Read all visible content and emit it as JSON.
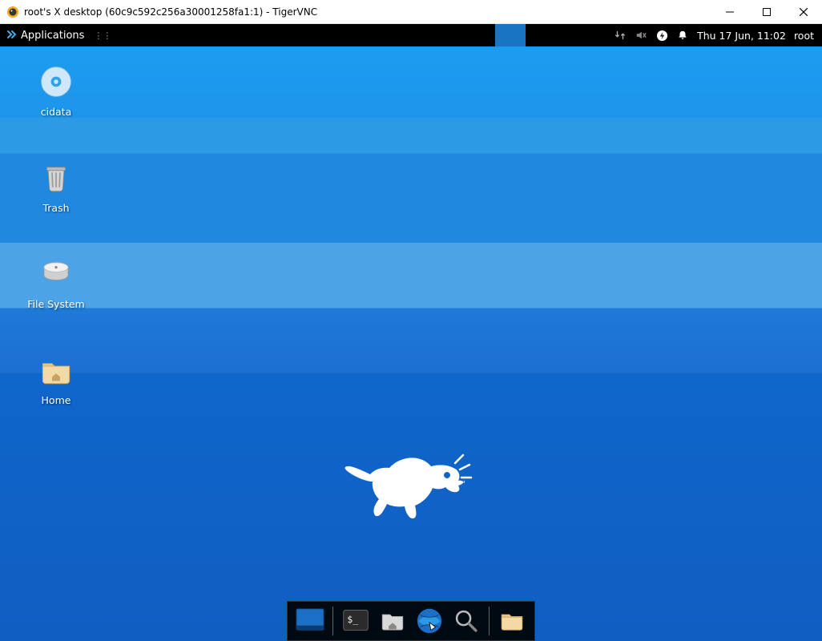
{
  "window": {
    "title": "root's X desktop (60c9c592c256a30001258fa1:1) - TigerVNC"
  },
  "panel": {
    "applications_label": "Applications",
    "clock": "Thu 17 Jun, 11:02",
    "user": "root"
  },
  "desktop_icons": {
    "cidata": "cidata",
    "trash": "Trash",
    "filesystem": "File System",
    "home": "Home"
  },
  "dock": {
    "items": [
      {
        "name": "show-desktop"
      },
      {
        "name": "terminal"
      },
      {
        "name": "file-manager"
      },
      {
        "name": "web-browser"
      },
      {
        "name": "app-finder"
      },
      {
        "name": "home-folder"
      }
    ]
  }
}
